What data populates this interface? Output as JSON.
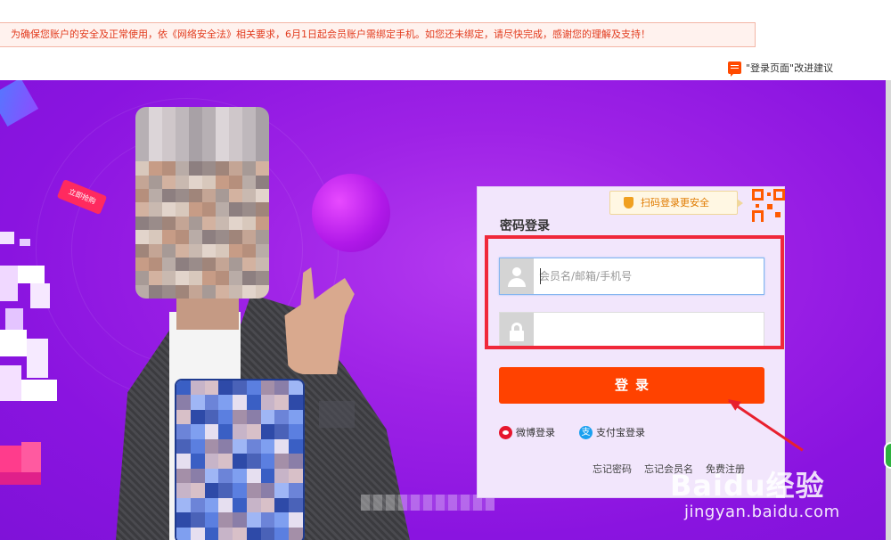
{
  "notice": {
    "text": "为确保您账户的安全及正常使用，依《网络安全法》相关要求，6月1日起会员账户需绑定手机。如您还未绑定，请尽快完成，感谢您的理解及支持！"
  },
  "feedback": {
    "label": "\"登录页面\"改进建议"
  },
  "banner": {
    "tag": "立即抢购"
  },
  "login": {
    "qr_tip": "扫码登录更安全",
    "title": "密码登录",
    "username": {
      "value": "",
      "placeholder": "会员名/邮箱/手机号"
    },
    "password": {
      "value": "",
      "placeholder": ""
    },
    "submit_label": "登录",
    "third_party": [
      {
        "label": "微博登录",
        "icon": "weibo-icon"
      },
      {
        "label": "支付宝登录",
        "icon": "alipay-icon"
      }
    ],
    "links": [
      "忘记密码",
      "忘记会员名",
      "免费注册"
    ]
  },
  "watermark": {
    "logo": "Baidu经验",
    "url": "jingyan.baidu.com"
  },
  "colors": {
    "accent": "#ff4200",
    "banner_purple": "#9e22e6",
    "annotation_red": "#f0283a",
    "notice_text": "#e23b1e"
  }
}
